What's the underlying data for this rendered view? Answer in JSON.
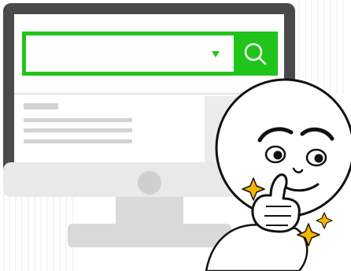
{
  "illustration": {
    "search": {
      "value": "",
      "placeholder": ""
    },
    "icons": {
      "search": "search-icon",
      "dropdown": "dropdown-triangle-icon",
      "sparkle": "sparkle-icon"
    },
    "colors": {
      "accent_green": "#21c41b",
      "monitor_frame": "#4a4a4a",
      "stand": "#d9d9d9",
      "screen_content": "#d3d3d3",
      "sparkle_yellow": "#f7b500"
    }
  }
}
